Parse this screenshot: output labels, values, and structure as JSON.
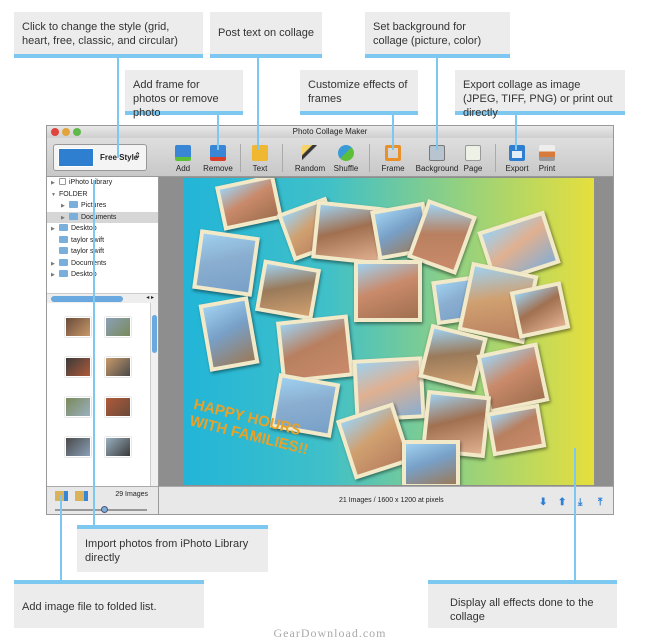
{
  "callouts": {
    "style": "Click to change the style (grid, heart, free, classic, and circular)",
    "text": "Post text on collage",
    "background": "Set background for collage (picture, color)",
    "frame_photo": "Add frame for photos or remove photo",
    "effects": "Customize effects of frames",
    "export": "Export collage as image (JPEG, TIFF, PNG) or print out directly",
    "iphoto": "Import photos from iPhoto Library directly",
    "add_file": "Add image file to folded list.",
    "display": "Display all effects done to the collage"
  },
  "window": {
    "title": "Photo Collage Maker"
  },
  "toolbar": {
    "style_label": "Free Style",
    "add": "Add",
    "remove": "Remove",
    "text": "Text",
    "random": "Random",
    "shuffle": "Shuffle",
    "frame": "Frame",
    "background": "Background",
    "page": "Page",
    "export": "Export",
    "print": "Print"
  },
  "sidebar": {
    "tree": [
      {
        "label": "iPhoto Library",
        "level": 0,
        "arrow": "▶"
      },
      {
        "label": "FOLDER",
        "level": 0,
        "arrow": "▼"
      },
      {
        "label": "Pictures",
        "level": 1,
        "arrow": "▶"
      },
      {
        "label": "Documents",
        "level": 1,
        "arrow": "▶",
        "selected": true
      },
      {
        "label": "Desktop",
        "level": 0,
        "arrow": "▶"
      },
      {
        "label": "taylor swift",
        "level": 0,
        "arrow": ""
      },
      {
        "label": "taylor swift",
        "level": 0,
        "arrow": ""
      },
      {
        "label": "Documents",
        "level": 0,
        "arrow": "▶"
      },
      {
        "label": "Desktop",
        "level": 0,
        "arrow": "▶"
      }
    ],
    "image_count": "29 Images"
  },
  "collage": {
    "caption_line1": "HAPPY HOURS",
    "caption_line2": "WITH FAMILIES!!",
    "caption_color": "#e8a22a"
  },
  "status": {
    "info": "21 Images / 1600 x 1200 at pixels"
  },
  "watermark": "GearDownload.com",
  "colors": {
    "accent_line": "#7cc8f0",
    "callout_bg": "#ececec"
  }
}
